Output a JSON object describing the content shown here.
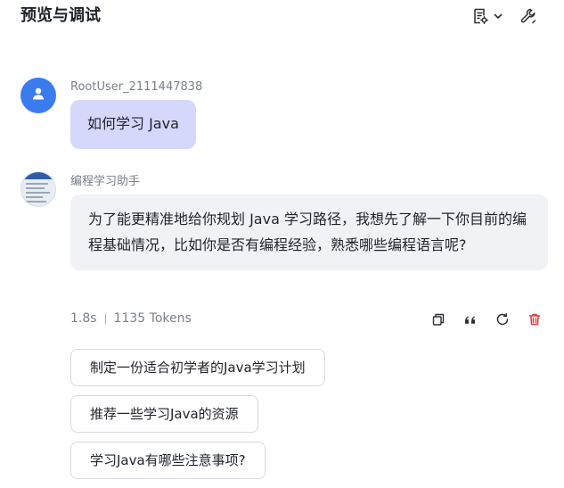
{
  "header": {
    "title": "预览与调试"
  },
  "conversation": {
    "user": {
      "name": "RootUser_2111447838",
      "message": "如何学习 Java"
    },
    "bot": {
      "name": "编程学习助手",
      "message": "为了能更精准地给你规划 Java 学习路径，我想先了解一下你目前的编程基础情况，比如你是否有编程经验，熟悉哪些编程语言呢?",
      "time": "1.8s",
      "tokens": "1135 Tokens"
    }
  },
  "suggestions": [
    "制定一份适合初学者的Java学习计划",
    "推荐一些学习Java的资源",
    "学习Java有哪些注意事项?"
  ],
  "colors": {
    "user_avatar": "#3a7cf0",
    "user_bubble": "#d5d8fb",
    "bot_bubble": "#f1f2f6",
    "delete_icon": "#e03a3a"
  },
  "icons": {
    "header_actions": [
      "document-settings-icon",
      "chevron-down-icon",
      "wrench-icon"
    ],
    "message_actions": [
      "copy-icon",
      "quote-icon",
      "refresh-icon",
      "delete-icon"
    ]
  }
}
